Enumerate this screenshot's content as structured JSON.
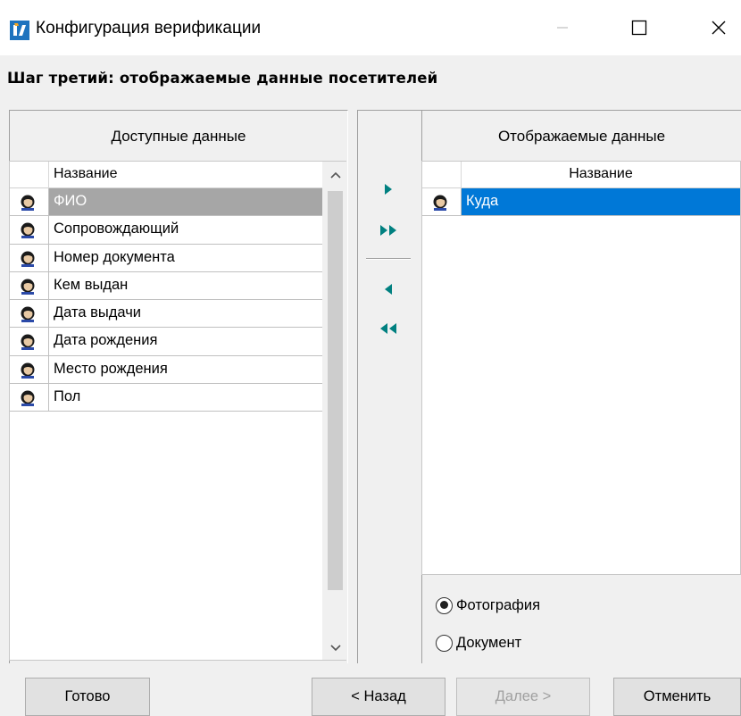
{
  "window": {
    "title": "Конфигурация верификации",
    "icon": "app-logo-icon"
  },
  "step_title": "Шаг третий: отображаемые данные посетителей",
  "available": {
    "title": "Доступные данные",
    "column_header": "Название",
    "selected_index": 0,
    "items": [
      "ФИО",
      "Сопровождающий",
      "Номер документа",
      "Кем выдан",
      "Дата выдачи",
      "Дата рождения",
      "Место рождения",
      "Пол"
    ]
  },
  "displayed": {
    "title": "Отображаемые данные",
    "column_header": "Название",
    "selected_index": 0,
    "items": [
      "Куда"
    ]
  },
  "transfer_buttons": [
    "move-right-icon",
    "move-all-right-icon",
    "move-left-icon",
    "move-all-left-icon"
  ],
  "radio": {
    "selected": "photo",
    "photo_label": "Фотография",
    "document_label": "Документ"
  },
  "buttons": {
    "done": "Готово",
    "back": "< Назад",
    "next": "Далее >",
    "cancel": "Отменить"
  },
  "colors": {
    "selection_blue": "#0078d7",
    "selection_gray": "#a6a6a6",
    "arrow_teal": "#008080"
  }
}
